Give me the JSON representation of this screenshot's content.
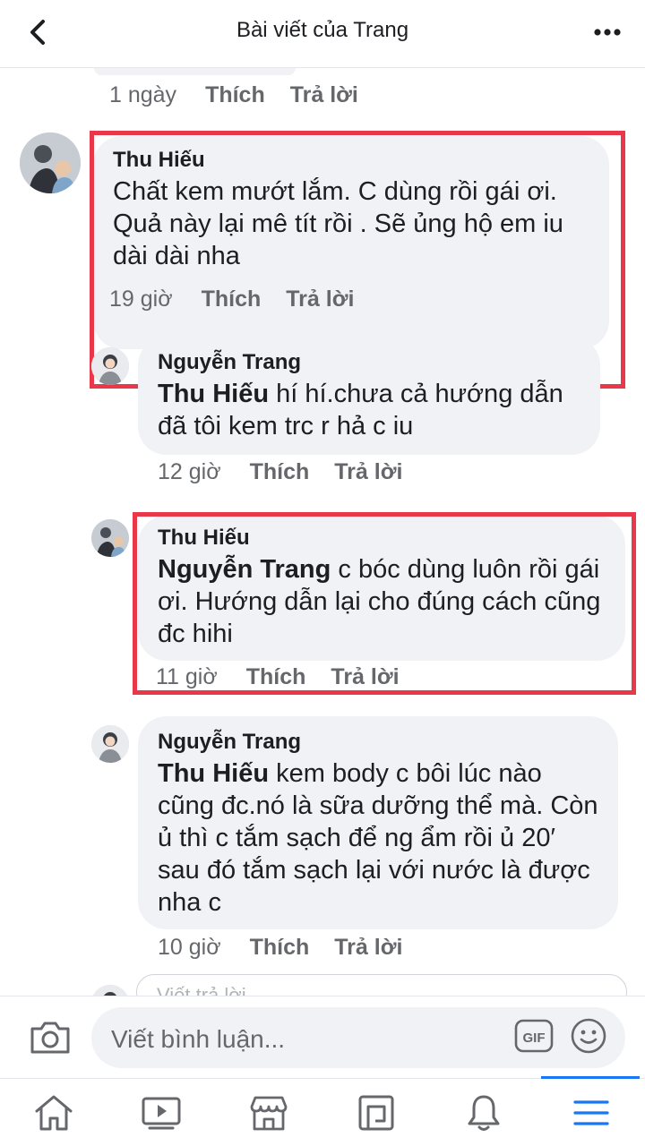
{
  "header": {
    "title": "Bài viết của Trang",
    "back_icon": "chevron-left-icon",
    "more_icon": "more-horizontal-icon"
  },
  "actions": {
    "like": "Thích",
    "reply": "Trả lời"
  },
  "previous": {
    "time": "1 ngày"
  },
  "comments": [
    {
      "author": "Thu Hiếu",
      "text": "Chất kem mướt lắm. C dùng rồi gái ơi. Quả này lại mê tít rồi . Sẽ ủng hộ em iu dài dài nha",
      "time": "19 giờ",
      "highlighted": true
    },
    {
      "author": "Nguyễn Trang",
      "mention": "Thu Hiếu",
      "text": " hí hí.chưa cả hướng dẫn đã tôi kem trc r hả c iu",
      "time": "12 giờ",
      "highlighted": false
    },
    {
      "author": "Thu Hiếu",
      "mention": "Nguyễn Trang",
      "text": " c bóc dùng luôn rồi gái ơi. Hướng dẫn lại cho đúng cách cũng đc hihi",
      "time": "11 giờ",
      "highlighted": true
    },
    {
      "author": "Nguyễn Trang",
      "mention": "Thu Hiếu",
      "text": " kem body c bôi lúc nào cũng đc.nó là sữa dưỡng thể mà. Còn ủ thì c tắm sạch để ng ẩm rồi ủ 20′ sau đó tắm sạch lại với nước là được nha c",
      "time": "10 giờ",
      "highlighted": false
    }
  ],
  "reply_input": {
    "placeholder": "Viết trả lời..."
  },
  "composer": {
    "placeholder": "Viết bình luận...",
    "gif_label": "GIF"
  },
  "nav": {
    "items": [
      "home-icon",
      "video-icon",
      "marketplace-icon",
      "pages-icon",
      "notifications-icon",
      "menu-icon"
    ],
    "active_index": 5
  },
  "colors": {
    "highlight": "#e8384a",
    "accent": "#1877f2",
    "bubble": "#f0f2f5"
  }
}
